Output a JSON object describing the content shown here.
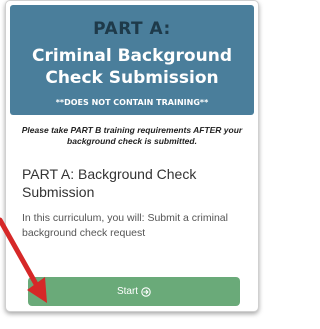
{
  "banner": {
    "line1": "PART A:",
    "line2_a": "Criminal Background",
    "line2_b": "Check Submission",
    "note": "**DOES NOT CONTAIN TRAINING**"
  },
  "instruction": {
    "prefix": "Please take ",
    "bold": "PART B",
    "suffix": " training requirements AFTER your background check is submitted."
  },
  "section_title": "PART A: Background Check Submission",
  "description": "In this curriculum, you will: Submit a criminal background check request",
  "start_button": {
    "label": "Start",
    "icon": "arrow-circle-right-icon"
  },
  "colors": {
    "banner_bg": "#4a7e9b",
    "button_bg": "#6aaa79",
    "pointer_arrow": "#d62828"
  }
}
